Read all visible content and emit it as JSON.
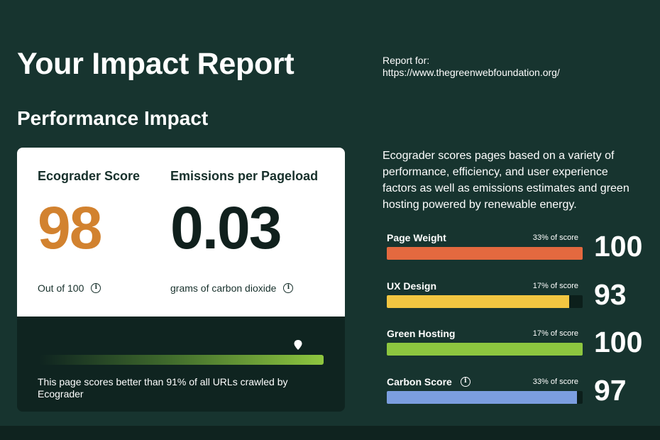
{
  "header": {
    "title": "Your Impact Report",
    "report_for_label": "Report for:",
    "report_url": "https://www.thegreenwebfoundation.org/"
  },
  "section": {
    "title": "Performance Impact"
  },
  "card": {
    "score": {
      "label": "Ecograder Score",
      "value": "98",
      "sub": "Out of 100",
      "color": "#d2822f"
    },
    "emissions": {
      "label": "Emissions per Pageload",
      "value": "0.03",
      "sub": "grams of carbon dioxide"
    },
    "percentile": 91,
    "percentile_text": "This page scores better than 91% of all URLs crawled by Ecograder"
  },
  "description": "Ecograder scores pages based on a variety of performance, efficiency, and user experience factors as well as emissions estimates and green hosting powered by renewable energy.",
  "breakdown": [
    {
      "name": "Page Weight",
      "weight": "33% of score",
      "value": "100",
      "fill": 1.0,
      "color": "#e4693f",
      "info": false
    },
    {
      "name": "UX Design",
      "weight": "17% of score",
      "value": "93",
      "fill": 0.93,
      "color": "#f2c641",
      "info": false
    },
    {
      "name": "Green Hosting",
      "weight": "17% of score",
      "value": "100",
      "fill": 1.0,
      "color": "#8dc63f",
      "info": false
    },
    {
      "name": "Carbon Score",
      "weight": "33% of score",
      "value": "97",
      "fill": 0.97,
      "color": "#7b9ee0",
      "info": true
    }
  ]
}
